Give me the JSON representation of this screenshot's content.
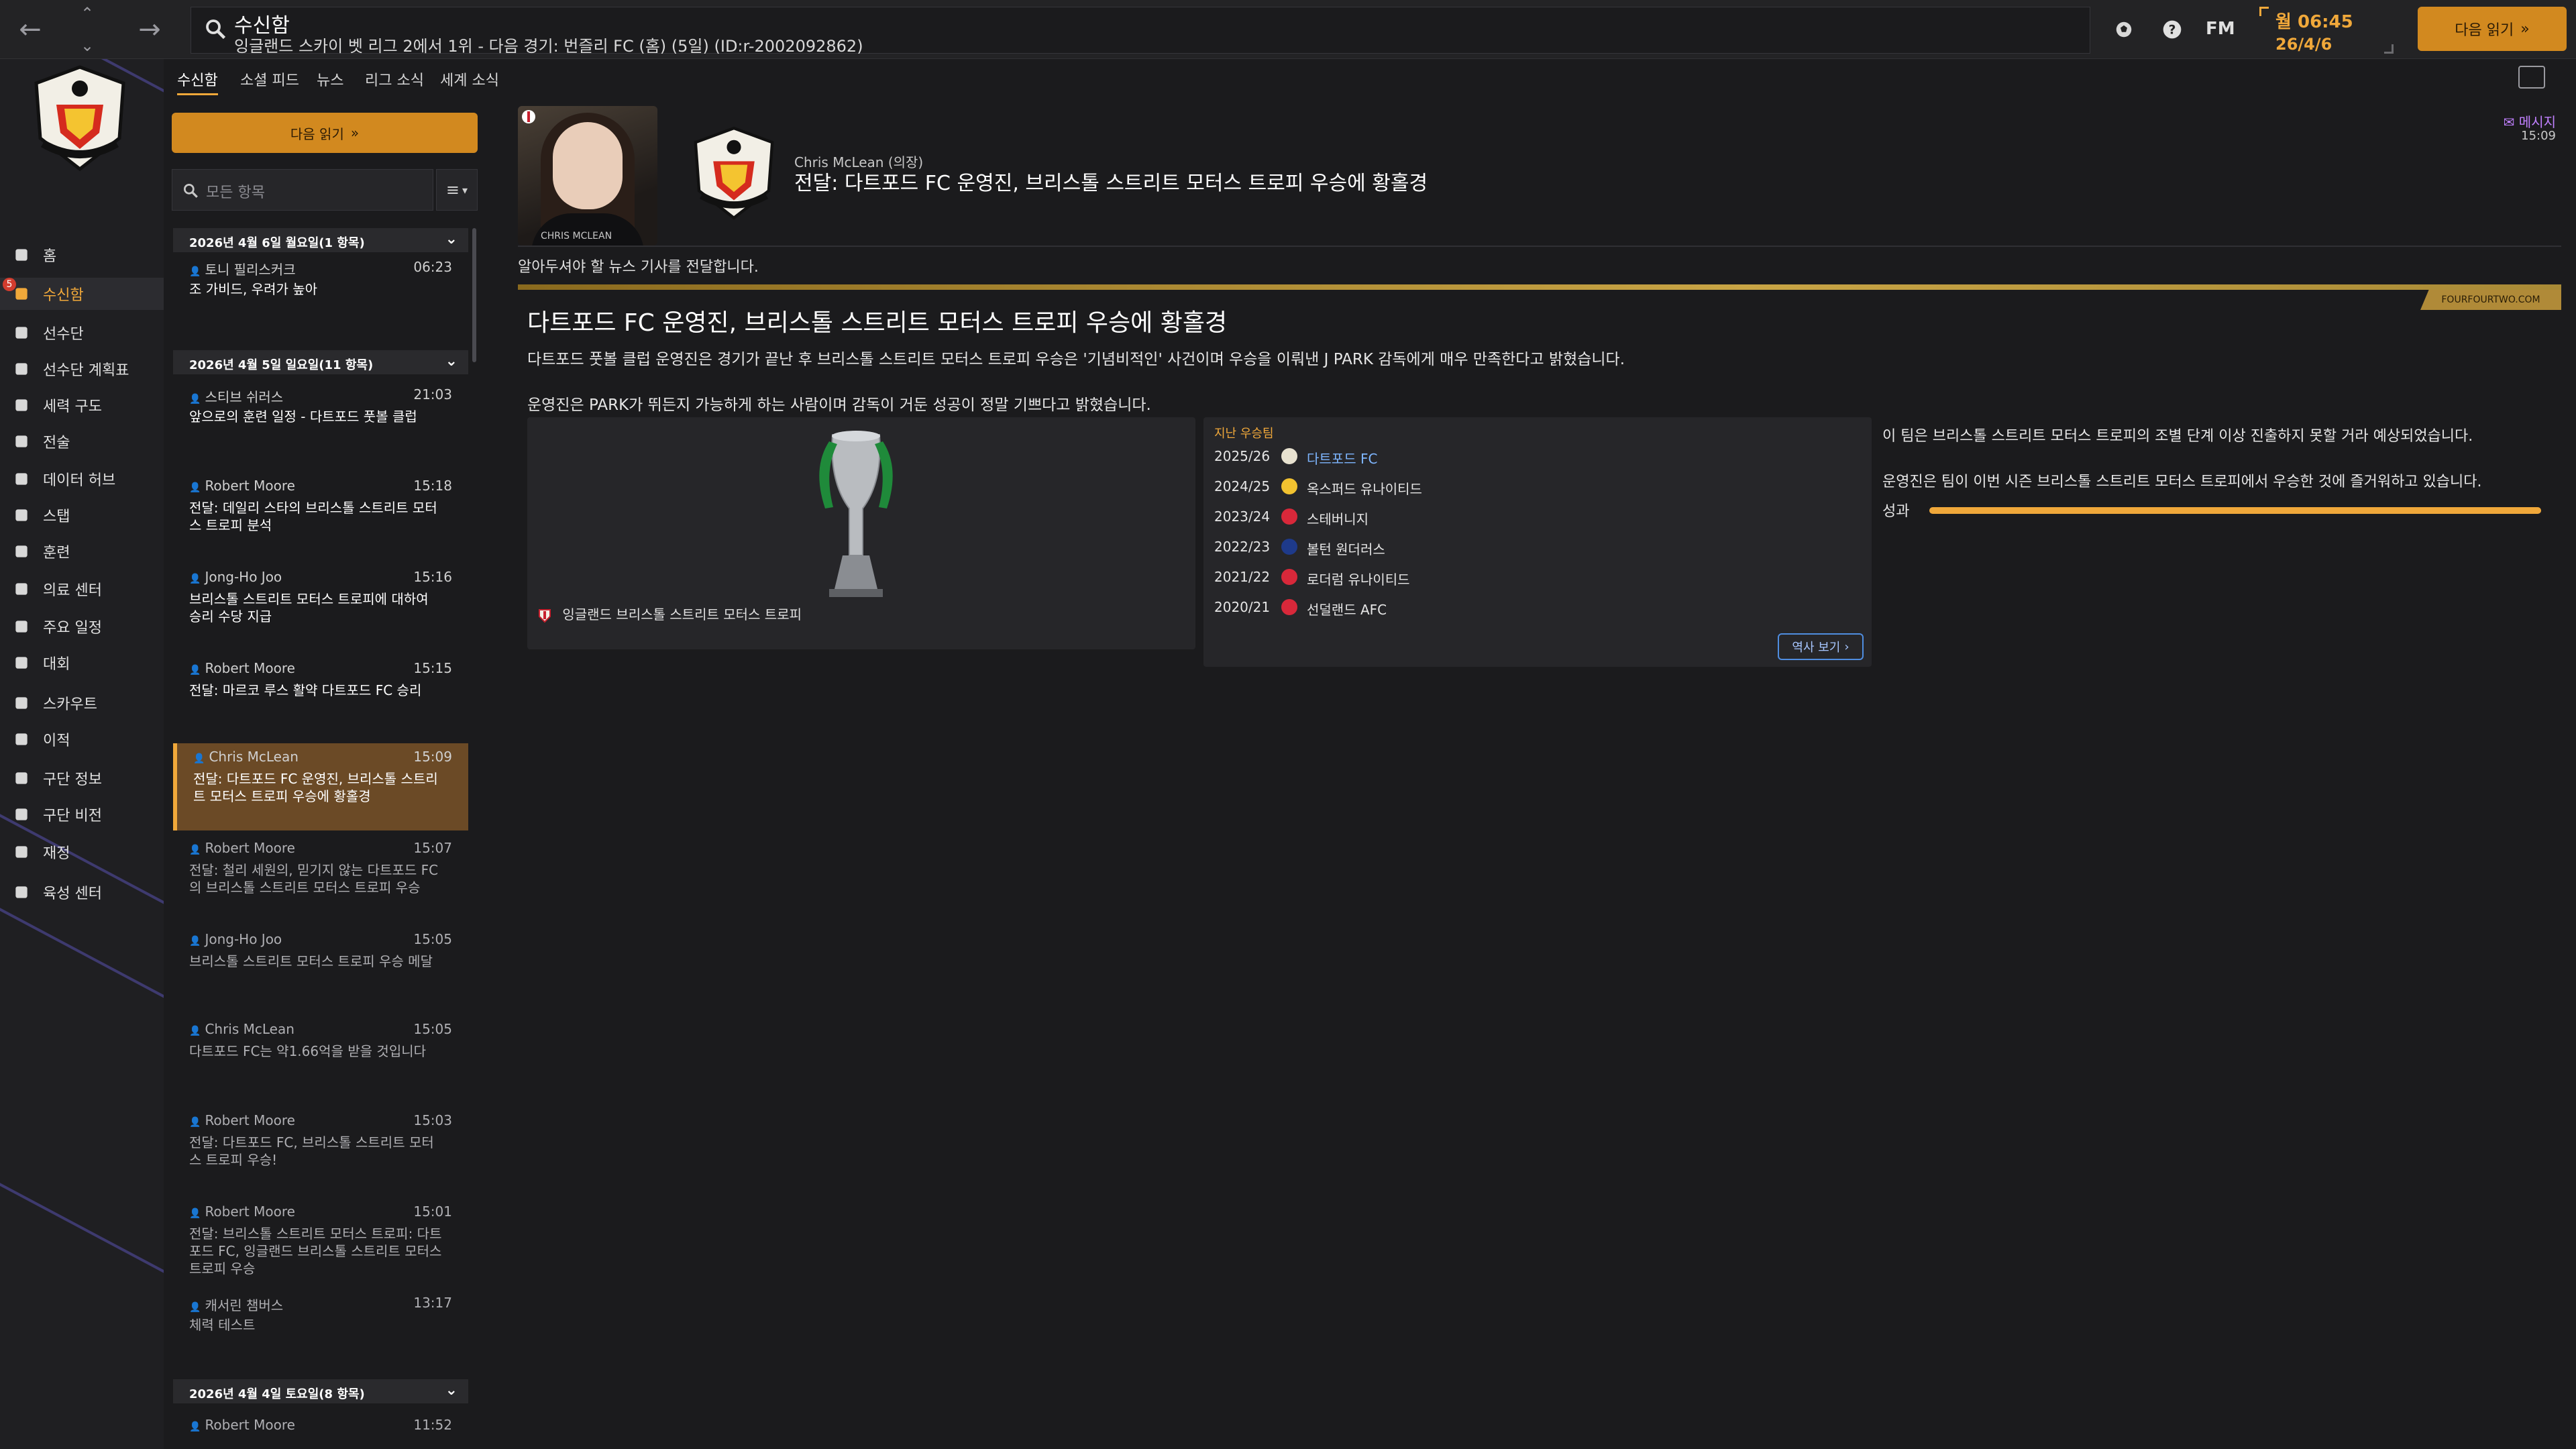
{
  "topbar": {
    "title": "수신함",
    "subtitle": "잉글랜드 스카이 벳 리그 2에서 1위 - 다음 경기: 번즐리 FC (홈) (5일) (ID:r-2002092862)",
    "fm_label": "FM",
    "time": "월 06:45",
    "date": "26/4/6",
    "continue_label": "다음 읽기"
  },
  "sidebar": {
    "badge_count": "5",
    "items": [
      {
        "label": "홈",
        "icon": "home-icon"
      },
      {
        "label": "수신함",
        "icon": "inbox-icon"
      },
      {
        "label": "선수단",
        "icon": "squad-icon"
      },
      {
        "label": "선수단 계획표",
        "icon": "clipboard-icon"
      },
      {
        "label": "세력 구도",
        "icon": "dynamics-icon"
      },
      {
        "label": "전술",
        "icon": "tactics-icon"
      },
      {
        "label": "데이터 허브",
        "icon": "data-hub-icon"
      },
      {
        "label": "스탭",
        "icon": "staff-icon"
      },
      {
        "label": "훈련",
        "icon": "training-icon"
      },
      {
        "label": "의료 센터",
        "icon": "medical-icon"
      },
      {
        "label": "주요 일정",
        "icon": "calendar-icon"
      },
      {
        "label": "대회",
        "icon": "trophy-icon"
      },
      {
        "label": "스카우트",
        "icon": "scout-icon"
      },
      {
        "label": "이적",
        "icon": "transfer-icon"
      },
      {
        "label": "구단 정보",
        "icon": "club-info-icon"
      },
      {
        "label": "구단 비전",
        "icon": "vision-icon"
      },
      {
        "label": "재정",
        "icon": "finance-icon"
      },
      {
        "label": "육성 센터",
        "icon": "development-icon"
      }
    ]
  },
  "inbox": {
    "tabs": [
      "수신함",
      "소셜 피드",
      "뉴스",
      "리그 소식",
      "세계 소식"
    ],
    "continue_label": "다음 읽기",
    "filter_placeholder": "모든 항목",
    "filter_menu_icon": "≡",
    "groups": [
      {
        "header": "2026년 4월 6일 월요일(1 항목)"
      },
      {
        "header": "2026년 4월 5일 일요일(11 항목)"
      },
      {
        "header": "2026년 4월 4일 토요일(8 항목)"
      }
    ],
    "messages": [
      {
        "sender": "토니 필리스커크",
        "time": "06:23",
        "subject": "조 가비드, 우려가 높아",
        "read": false
      },
      {
        "sender": "스티브 쉬러스",
        "time": "21:03",
        "subject": "앞으로의 훈련 일정 - 다트포드 풋볼 클럽",
        "read": false
      },
      {
        "sender": "Robert Moore",
        "time": "15:18",
        "subject": "전달: 데일리 스타의 브리스톨 스트리트 모터스 트로피 분석",
        "read": false
      },
      {
        "sender": "Jong-Ho Joo",
        "time": "15:16",
        "subject": "브리스톨 스트리트 모터스 트로피에 대하여 승리 수당 지급",
        "read": false
      },
      {
        "sender": "Robert Moore",
        "time": "15:15",
        "subject": "전달: 마르코 루스 활약 다트포드 FC 승리",
        "read": false
      },
      {
        "sender": "Chris McLean",
        "time": "15:09",
        "subject": "전달: 다트포드 FC 운영진, 브리스톨 스트리트 모터스 트로피 우승에 황홀경",
        "read": false
      },
      {
        "sender": "Robert Moore",
        "time": "15:07",
        "subject": "전달: 철리 세원의, 믿기지 않는 다트포드 FC의 브리스톨 스트리트 모터스 트로피 우승",
        "read": true
      },
      {
        "sender": "Jong-Ho Joo",
        "time": "15:05",
        "subject": "브리스톨 스트리트 모터스 트로피 우승 메달",
        "read": true
      },
      {
        "sender": "Chris McLean",
        "time": "15:05",
        "subject": "다트포드 FC는 약1.66억을 받을 것입니다",
        "read": true
      },
      {
        "sender": "Robert Moore",
        "time": "15:03",
        "subject": "전달: 다트포드 FC, 브리스톨 스트리트 모터스 트로피 우승!",
        "read": true
      },
      {
        "sender": "Robert Moore",
        "time": "15:01",
        "subject": "전달: 브리스톨 스트리트 모터스 트로피: 다트포드 FC, 잉글랜드 브리스톨 스트리트 모터스 트로피 우승",
        "read": true
      },
      {
        "sender": "캐서린 챔버스",
        "time": "13:17",
        "subject": "체력 테스트",
        "read": true
      },
      {
        "sender": "Robert Moore",
        "time": "11:52",
        "subject": "",
        "read": true
      }
    ]
  },
  "message": {
    "avatar_caption": "CHRIS MCLEAN",
    "from": "Chris McLean (의장)",
    "headline": "전달: 다트포드 FC 운영진, 브리스톨 스트리트 모터스 트로피 우승에 황홀경",
    "tag": "메시지",
    "time": "15:09",
    "intro": "알아두셔야 할 뉴스 기사를 전달합니다.",
    "source": "FOURFOURTWO.COM",
    "article_title": "다트포드 FC 운영진, 브리스톨 스트리트 모터스 트로피 우승에 황홀경",
    "paragraph1": "다트포드 풋볼 클럽 운영진은 경기가 끝난 후 브리스톨 스트리트 모터스 트로피 우승은 '기념비적인' 사건이며 우승을 이뤄낸 J PARK 감독에게 매우 만족한다고 밝혔습니다.",
    "paragraph2": "운영진은 PARK가 뛰든지 가능하게 하는 사람이며 감독이 거둔 성공이 정말 기쁘다고 밝혔습니다.",
    "trophy_caption": "잉글랜드 브리스톨 스트리트 모터스 트로피",
    "winners_label": "지난 우승팀",
    "winners": [
      {
        "season": "2025/26",
        "team": "다트포드 FC",
        "crest_color": "#e8e2d0",
        "link": true
      },
      {
        "season": "2024/25",
        "team": "옥스퍼드 유나이티드",
        "crest_color": "#f2c230",
        "link": false
      },
      {
        "season": "2023/24",
        "team": "스테버니지",
        "crest_color": "#d8283a",
        "link": false
      },
      {
        "season": "2022/23",
        "team": "볼턴 원더러스",
        "crest_color": "#1e3a8a",
        "link": false
      },
      {
        "season": "2021/22",
        "team": "로더럼 유나이티드",
        "crest_color": "#d8283a",
        "link": false
      },
      {
        "season": "2020/21",
        "team": "선덜랜드 AFC",
        "crest_color": "#d8283a",
        "link": false
      }
    ],
    "history_button": "역사 보기",
    "prediction": "이 팀은 브리스톨 스트리트 모터스 트로피의 조별 단계 이상 진출하지 못할 거라 예상되었습니다.",
    "reaction": "운영진은 팀이 이번 시즌 브리스톨 스트리트 모터스 트로피에서 우승한 것에 즐거워하고 있습니다.",
    "performance_label": "성과",
    "performance_value": 1.0
  },
  "colors": {
    "accent": "#f0a83a",
    "link": "#7eb6ff",
    "tag": "#c080ff"
  }
}
